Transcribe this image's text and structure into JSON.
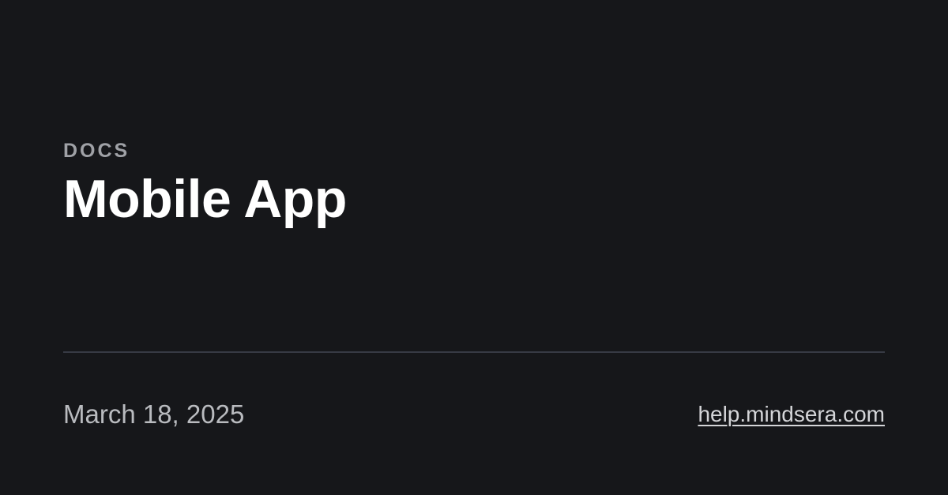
{
  "card": {
    "eyebrow": "DOCS",
    "title": "Mobile App",
    "date": "March 18, 2025",
    "site": "help.mindsera.com"
  },
  "colors": {
    "background": "#16171a",
    "title": "#ffffff",
    "eyebrow": "#9fa1a6",
    "divider": "#373a44",
    "meta": "#b9bbbf"
  }
}
